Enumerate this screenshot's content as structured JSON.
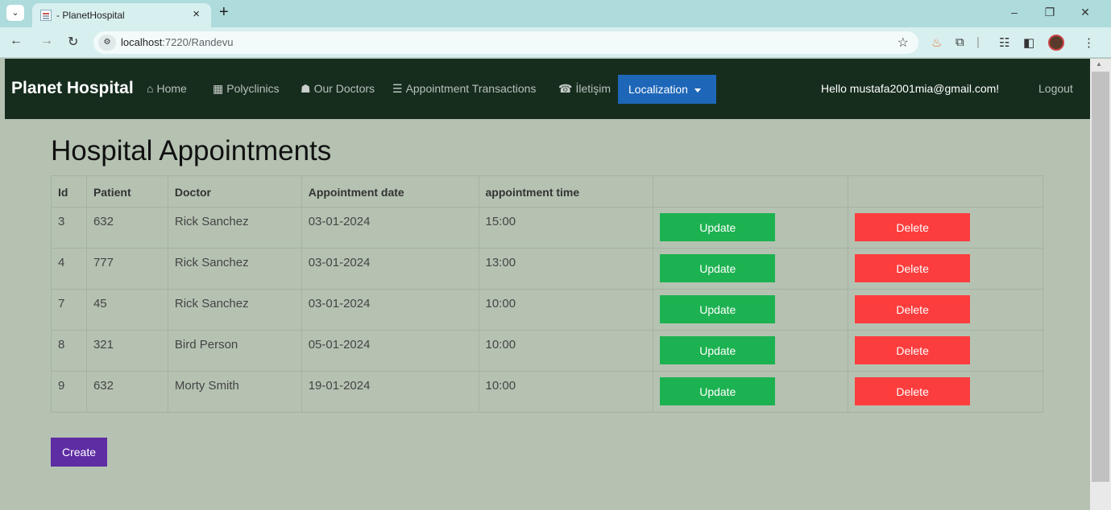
{
  "browser": {
    "tab_title": "- PlanetHospital",
    "tab_close": "×",
    "new_tab": "+",
    "url_host": "localhost",
    "url_rest": ":7220/Randevu",
    "win_minimize": "–",
    "win_restore": "❐",
    "win_close": "✕"
  },
  "navbar": {
    "brand": "Planet Hospital",
    "items": [
      {
        "icon": "home-icon",
        "glyph": "⌂",
        "label": "Home"
      },
      {
        "icon": "building-icon",
        "glyph": "▦",
        "label": "Polyclinics"
      },
      {
        "icon": "doctor-icon",
        "glyph": "☗",
        "label": "Our Doctors"
      },
      {
        "icon": "list-icon",
        "glyph": "☰",
        "label": "Appointment Transactions"
      },
      {
        "icon": "phone-icon",
        "glyph": "☎",
        "label": "İletişim"
      }
    ],
    "localization_label": "Localization",
    "greeting": "Hello mustafa2001mia@gmail.com!",
    "logout_label": "Logout"
  },
  "main": {
    "title": "Hospital Appointments",
    "columns": [
      "Id",
      "Patient",
      "Doctor",
      "Appointment date",
      "appointment time",
      "",
      ""
    ],
    "rows": [
      {
        "id": "3",
        "patient": "632",
        "doctor": "Rick Sanchez",
        "date": "03-01-2024",
        "time": "15:00"
      },
      {
        "id": "4",
        "patient": "777",
        "doctor": "Rick Sanchez",
        "date": "03-01-2024",
        "time": "13:00"
      },
      {
        "id": "7",
        "patient": "45",
        "doctor": "Rick Sanchez",
        "date": "03-01-2024",
        "time": "10:00"
      },
      {
        "id": "8",
        "patient": "321",
        "doctor": "Bird Person",
        "date": "05-01-2024",
        "time": "10:00"
      },
      {
        "id": "9",
        "patient": "632",
        "doctor": "Morty Smith",
        "date": "19-01-2024",
        "time": "10:00"
      }
    ],
    "update_label": "Update",
    "delete_label": "Delete",
    "create_label": "Create"
  },
  "colors": {
    "navbar_bg": "#162d1e",
    "page_bg": "#b5c2b2",
    "update": "#1db251",
    "delete": "#fc3d3d",
    "create": "#5e2ca3",
    "localization": "#1e67b8"
  }
}
